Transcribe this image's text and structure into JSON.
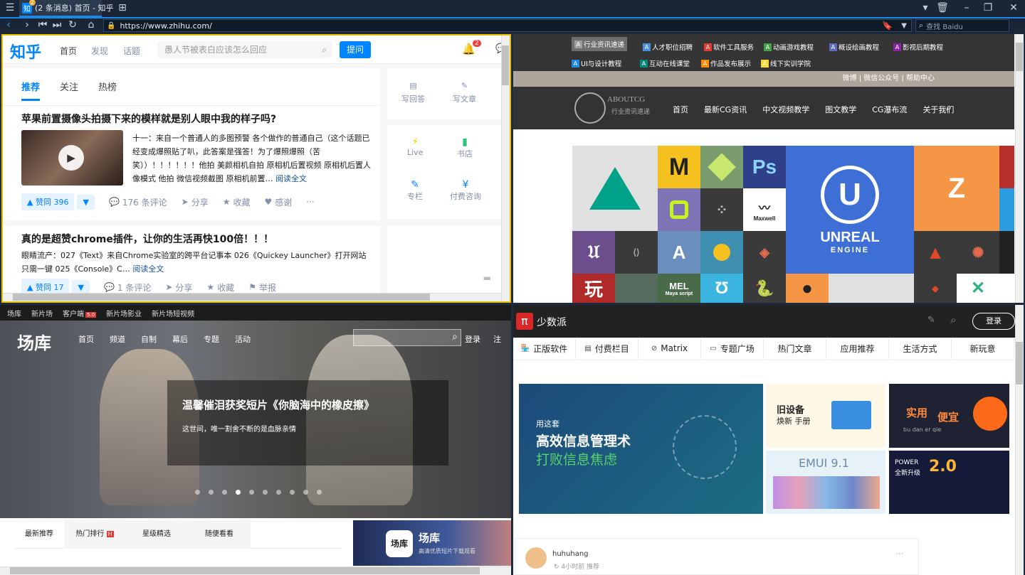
{
  "browser": {
    "tab_title": "(2 条消息) 首页 - 知乎",
    "tab_badge": "2",
    "url": "https://www.zhihu.com/",
    "search_placeholder": "查找 Baidu"
  },
  "zhihu": {
    "logo": "知乎",
    "nav": [
      "首页",
      "发现",
      "话题"
    ],
    "search_placeholder": "愚人节被表白应该怎么回应",
    "ask_button": "提问",
    "bell_badge": "2",
    "tabs": [
      "推荐",
      "关注",
      "热榜"
    ],
    "post1": {
      "title": "苹果前置摄像头拍摄下来的模样就是别人眼中我的样子吗?",
      "excerpt": "十一：来自一个普通人的多图预警 各个做作的普通自己（这个话题已经变成爆照贴了叭，此答案是强答！为了爆照爆照（苦笑））！！！！！！他拍 美颜相机自拍 原相机后置视频 原相机后置人像模式 他拍 微信视频截图 原相机前置…",
      "read_more": "阅读全文",
      "vote": "赞同 396",
      "comments": "176 条评论",
      "share": "分享",
      "fav": "收藏",
      "thanks": "感谢"
    },
    "post2": {
      "title": "真的是超赞chrome插件，让你的生活再快100倍！！！",
      "excerpt": "眼睛流产：027《Text》来自Chrome实验室的跨平台记事本 026《Quickey Launcher》打开网站只需一键 025《Console》C…",
      "read_more": "阅读全文",
      "vote": "赞同 17",
      "comments": "1 条评论",
      "share": "分享",
      "fav": "收藏",
      "report": "举报"
    },
    "side_actions": [
      "写回答",
      "写文章"
    ],
    "side_items": [
      "Live",
      "书店",
      "专栏",
      "付费咨询"
    ]
  },
  "cg": {
    "cats_row1": [
      "行业资讯速递",
      "人才职位招聘",
      "软件工具服务",
      "动画游戏教程",
      "概设绘画教程",
      "影视后期教程"
    ],
    "cats_row2": [
      "UI与设计教程",
      "互动在线课堂",
      "作品发布展示",
      "线下实训学院"
    ],
    "cat_colors": [
      "#9e9e9e",
      "#4a90e2",
      "#e53935",
      "#43a047",
      "#5c6bc0",
      "#8e24aa",
      "#1e88e5",
      "#00897b",
      "#fb8c00",
      "#fdd835"
    ],
    "links": [
      "微博",
      "微信公众号",
      "帮助中心"
    ],
    "logo_text": "ABOUTCG",
    "logo_sub": "行业资讯速递",
    "nav": [
      "首页",
      "最新CG资讯",
      "中文视频教学",
      "图文教学",
      "CG瀑布流",
      "关于我们"
    ],
    "tiles": {
      "m": "M",
      "ps": "Ps",
      "maxwell": "Maxwell",
      "unreal": "UNREAL",
      "engine": "ENGINE",
      "wan": "玩",
      "mel": "MEL",
      "mel_sub": "Maya script"
    }
  },
  "changku": {
    "topnav": [
      "场库",
      "新片场",
      "客户端",
      "新片场影业",
      "新片场短视频"
    ],
    "client_badge": "5.0",
    "logo": "场库",
    "nav": [
      "首页",
      "频道",
      "自制",
      "幕后",
      "专题",
      "活动"
    ],
    "login": "登录",
    "register": "注",
    "headline": "温馨催泪获奖短片《你脑海中的橡皮擦》",
    "subline": "这世间，唯一割舍不断的是血脉亲情",
    "tabs": [
      "最新推荐",
      "热门排行",
      "星级精选",
      "随便看看"
    ],
    "hot_badge": "H",
    "promo_title": "场库",
    "promo_sub": "高清优质短片下载观看",
    "promo_icon": "场库"
  },
  "sspai": {
    "logo_mark": "π",
    "logo": "少数派",
    "login": "登录",
    "nav": [
      "正版软件",
      "付费栏目",
      "Matrix",
      "专题广场",
      "热门文章",
      "应用推荐",
      "生活方式",
      "新玩意"
    ],
    "hero": {
      "line1": "用这套",
      "line2": "高效信息管理术",
      "line3": "打败信息焦虑"
    },
    "card1": {
      "line1": "旧设备",
      "line2": "焕新 手册"
    },
    "card2": {
      "line1": "实用",
      "line2": "便宜",
      "line3": "bu dan er qie"
    },
    "card3": {
      "text": "EMUI 9.1"
    },
    "card4": {
      "line1": "POWER",
      "line2": "全新升级",
      "line3": "2.0"
    },
    "author": "huhuhang",
    "meta": "4小时前 推荐"
  }
}
